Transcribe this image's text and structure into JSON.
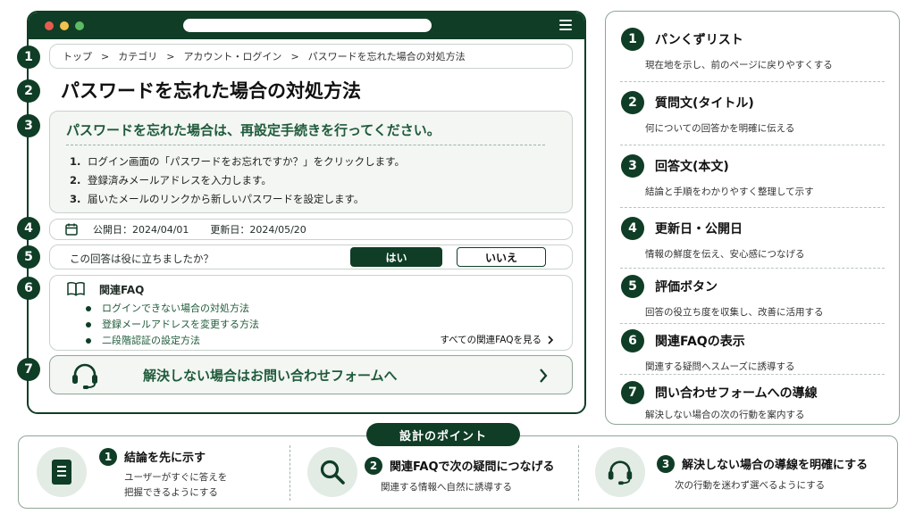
{
  "colors": {
    "primary": "#0f3d26",
    "accent": "#1f5a3a",
    "panel": "#f3f6f3"
  },
  "browser": {
    "breadcrumb": [
      "トップ",
      "カテゴリ",
      "アカウント・ログイン",
      "パスワードを忘れた場合の対処方法"
    ],
    "breadcrumb_sep": ">",
    "title": "パスワードを忘れた場合の対処方法",
    "answer": {
      "lead": "パスワードを忘れた場合は、再設定手続きを行ってください。",
      "steps": [
        {
          "n": "1.",
          "text": "ログイン画面の「パスワードをお忘れですか？」をクリックします。"
        },
        {
          "n": "2.",
          "text": "登録済みメールアドレスを入力します。"
        },
        {
          "n": "3.",
          "text": "届いたメールのリンクから新しいパスワードを設定します。"
        }
      ]
    },
    "dates": {
      "published": "公開日：2024/04/01",
      "updated": "更新日：2024/05/20"
    },
    "rating": {
      "question": "この回答は役に立ちましたか？",
      "yes": "はい",
      "no": "いいえ"
    },
    "faq": {
      "heading": "関連FAQ",
      "items": [
        "ログインできない場合の対処方法",
        "登録メールアドレスを変更する方法",
        "二段階認証の設定方法"
      ],
      "see_all": "すべての関連FAQを見る"
    },
    "contact": {
      "label": "解決しない場合はお問い合わせフォームへ"
    }
  },
  "markers": [
    "1",
    "2",
    "3",
    "4",
    "5",
    "6",
    "7"
  ],
  "legend": [
    {
      "n": "1",
      "title": "パンくずリスト",
      "desc": "現在地を示し、前のページに戻りやすくする"
    },
    {
      "n": "2",
      "title": "質問文(タイトル)",
      "desc": "何についての回答かを明確に伝える"
    },
    {
      "n": "3",
      "title": "回答文(本文)",
      "desc": "結論と手順をわかりやすく整理して示す"
    },
    {
      "n": "4",
      "title": "更新日・公開日",
      "desc": "情報の鮮度を伝え、安心感につなげる"
    },
    {
      "n": "5",
      "title": "評価ボタン",
      "desc": "回答の役立ち度を収集し、改善に活用する"
    },
    {
      "n": "6",
      "title": "関連FAQの表示",
      "desc": "関連する疑問へスムーズに誘導する"
    },
    {
      "n": "7",
      "title": "問い合わせフォームへの導線",
      "desc": "解決しない場合の次の行動を案内する"
    }
  ],
  "points": {
    "heading": "設計のポイント",
    "items": [
      {
        "n": "1",
        "title": "結論を先に示す",
        "desc1": "ユーザーがすぐに答えを",
        "desc2": "把握できるようにする",
        "icon": "document-icon"
      },
      {
        "n": "2",
        "title": "関連FAQで次の疑問につなげる",
        "desc1": "関連する情報へ自然に誘導する",
        "desc2": "",
        "icon": "search-icon"
      },
      {
        "n": "3",
        "title": "解決しない場合の導線を明確にする",
        "desc1": "次の行動を迷わず選べるようにする",
        "desc2": "",
        "icon": "headset-icon"
      }
    ]
  }
}
